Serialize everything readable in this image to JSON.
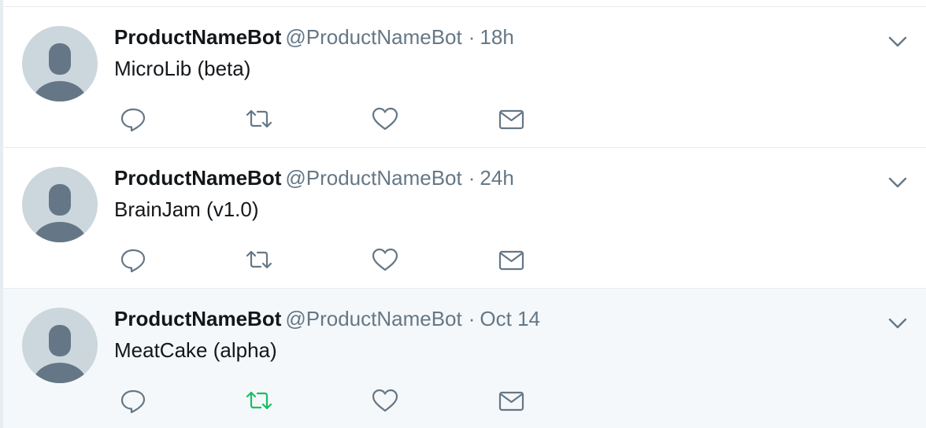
{
  "colors": {
    "name": "#14171a",
    "secondary": "#657786",
    "icon": "#657786",
    "retweeted": "#17bf63",
    "highlight_bg": "#f5f8fa",
    "divider": "#e6ecf0"
  },
  "tweets": [
    {
      "name": "ProductNameBot",
      "handle": "@ProductNameBot",
      "separator": "·",
      "time": "18h",
      "text": "MicroLib (beta)",
      "retweeted": false,
      "icons": [
        "avatar-placeholder",
        "chevron-down-icon",
        "reply-icon",
        "retweet-icon",
        "heart-icon",
        "envelope-icon"
      ]
    },
    {
      "name": "ProductNameBot",
      "handle": "@ProductNameBot",
      "separator": "·",
      "time": "24h",
      "text": "BrainJam (v1.0)",
      "retweeted": false,
      "icons": [
        "avatar-placeholder",
        "chevron-down-icon",
        "reply-icon",
        "retweet-icon",
        "heart-icon",
        "envelope-icon"
      ]
    },
    {
      "name": "ProductNameBot",
      "handle": "@ProductNameBot",
      "separator": "·",
      "time": "Oct 14",
      "text": "MeatCake (alpha)",
      "retweeted": true,
      "highlighted": true,
      "icons": [
        "avatar-placeholder",
        "chevron-down-icon",
        "reply-icon",
        "retweet-icon",
        "heart-icon",
        "envelope-icon"
      ]
    }
  ]
}
